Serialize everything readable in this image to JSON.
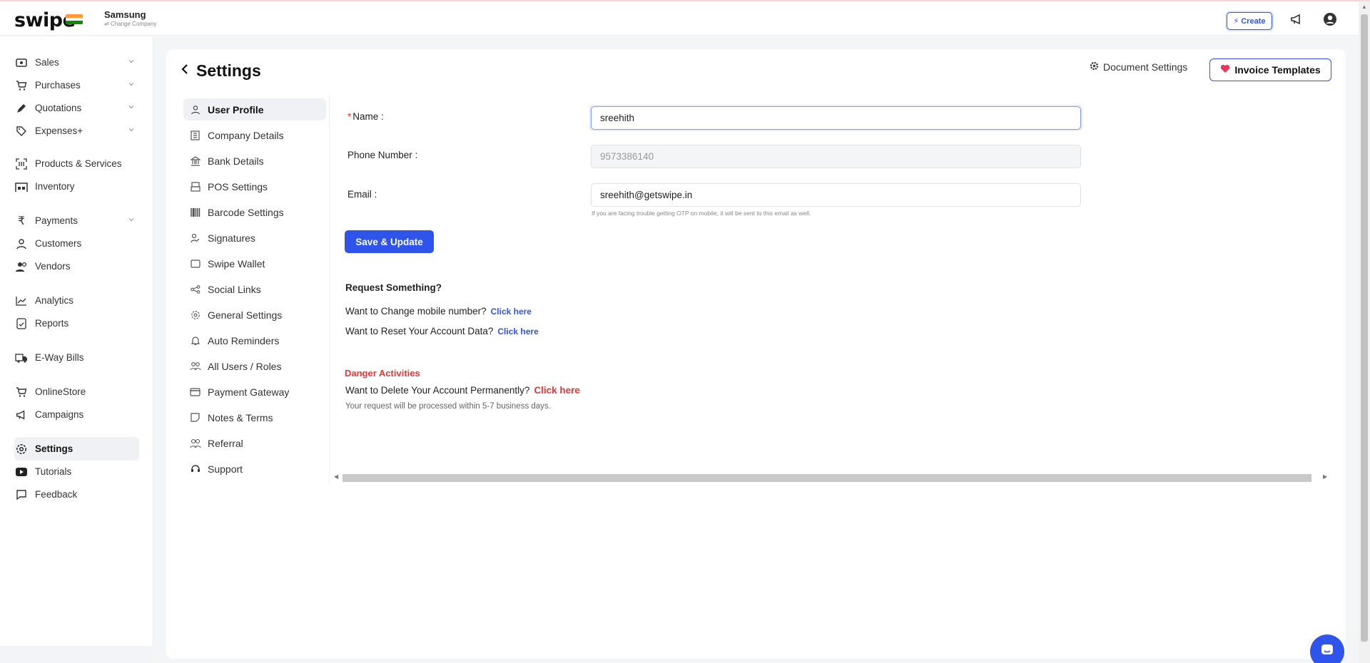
{
  "topbar": {
    "logo": "swipe",
    "company_name": "Samsung",
    "change_company": "⇄ Change Company",
    "create_label": "Create"
  },
  "sidebar": {
    "items": [
      {
        "label": "Sales",
        "icon": "cash-icon",
        "chevron": true
      },
      {
        "label": "Purchases",
        "icon": "cart-icon",
        "chevron": true
      },
      {
        "label": "Quotations",
        "icon": "pen-icon",
        "chevron": true
      },
      {
        "label": "Expenses+",
        "icon": "tag-icon",
        "chevron": true
      },
      {
        "label": "Products & Services",
        "icon": "barcode-scan-icon",
        "chevron": false
      },
      {
        "label": "Inventory",
        "icon": "warehouse-icon",
        "chevron": false
      },
      {
        "label": "Payments",
        "icon": "rupee-icon",
        "chevron": true
      },
      {
        "label": "Customers",
        "icon": "user-icon",
        "chevron": false
      },
      {
        "label": "Vendors",
        "icon": "users-icon",
        "chevron": false
      },
      {
        "label": "Analytics",
        "icon": "chart-icon",
        "chevron": false
      },
      {
        "label": "Reports",
        "icon": "report-icon",
        "chevron": false
      },
      {
        "label": "E-Way Bills",
        "icon": "truck-icon",
        "chevron": false
      },
      {
        "label": "OnlineStore",
        "icon": "store-icon",
        "chevron": false
      },
      {
        "label": "Campaigns",
        "icon": "megaphone-icon",
        "chevron": false
      },
      {
        "label": "Settings",
        "icon": "gear-icon",
        "chevron": false,
        "active": true
      },
      {
        "label": "Tutorials",
        "icon": "youtube-icon",
        "chevron": false
      },
      {
        "label": "Feedback",
        "icon": "message-icon",
        "chevron": false
      }
    ]
  },
  "header": {
    "title": "Settings",
    "document_settings": "Document Settings",
    "invoice_templates": "Invoice Templates"
  },
  "settings_nav": [
    {
      "label": "User Profile",
      "icon": "user-icon",
      "active": true
    },
    {
      "label": "Company Details",
      "icon": "building-icon"
    },
    {
      "label": "Bank Details",
      "icon": "bank-icon"
    },
    {
      "label": "POS Settings",
      "icon": "pos-icon"
    },
    {
      "label": "Barcode Settings",
      "icon": "barcode-icon"
    },
    {
      "label": "Signatures",
      "icon": "signature-icon"
    },
    {
      "label": "Swipe Wallet",
      "icon": "wallet-icon"
    },
    {
      "label": "Social Links",
      "icon": "share-icon"
    },
    {
      "label": "General Settings",
      "icon": "gear-icon"
    },
    {
      "label": "Auto Reminders",
      "icon": "bell-icon"
    },
    {
      "label": "All Users / Roles",
      "icon": "users-roles-icon"
    },
    {
      "label": "Payment Gateway",
      "icon": "credit-card-icon"
    },
    {
      "label": "Notes & Terms",
      "icon": "note-icon"
    },
    {
      "label": "Referral",
      "icon": "referral-icon"
    },
    {
      "label": "Support",
      "icon": "headset-icon"
    }
  ],
  "form": {
    "name_label": "Name",
    "name_value": "sreehith",
    "phone_label": "Phone Number",
    "phone_value": "9573386140",
    "email_label": "Email",
    "email_value": "sreehith@getswipe.in",
    "email_hint": "If you are facing trouble getting OTP on mobile, it will be sent to this email as well.",
    "save_label": "Save & Update"
  },
  "requests": {
    "title": "Request Something?",
    "change_mobile": "Want to Change mobile number?",
    "reset_data": "Want to Reset Your Account Data?",
    "click_here": "Click here"
  },
  "danger": {
    "title": "Danger Activities",
    "delete_text": "Want to Delete Your Account Permanently?",
    "click_here": "Click here",
    "note": "Your request will be processed within 5-7 business days."
  },
  "colors": {
    "accent": "#2f54eb",
    "danger": "#e53935",
    "heart": "#e8365d"
  }
}
